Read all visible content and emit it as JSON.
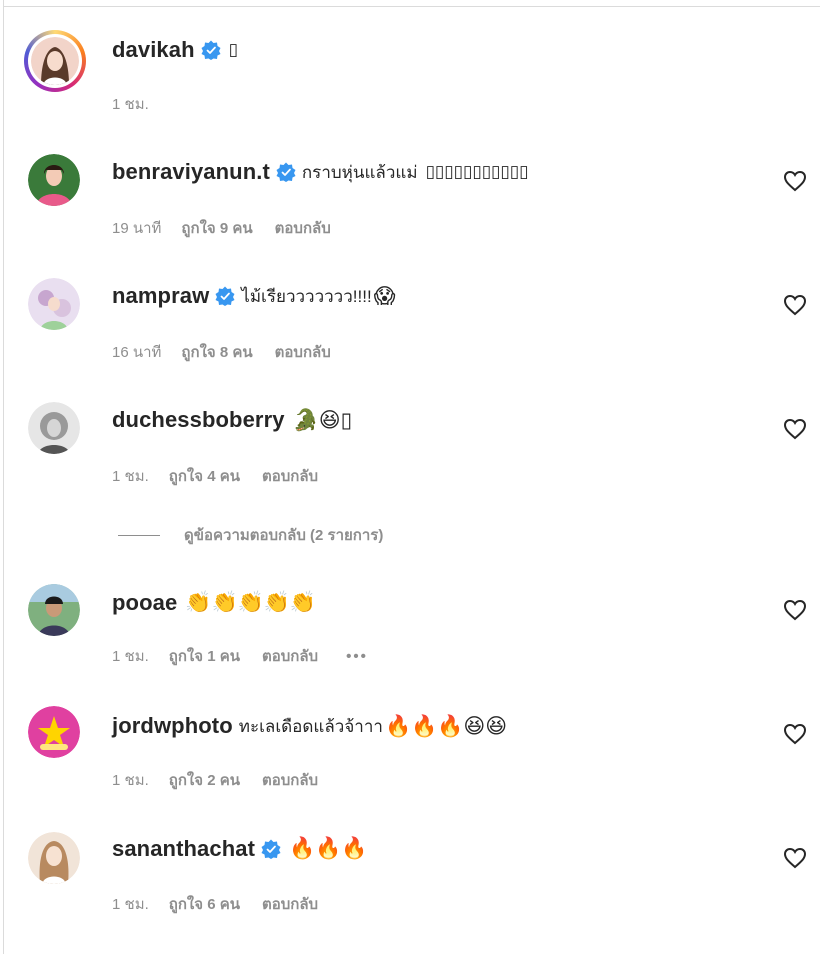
{
  "comments": [
    {
      "username": "davikah",
      "verified": true,
      "text": "",
      "emoji": "▯",
      "time": "1 ชม.",
      "likes": "",
      "reply": "",
      "avatar_colors": [
        "#f2d4c9",
        "#5a3a2a"
      ],
      "has_heart": false
    },
    {
      "username": "benraviyanun.t",
      "verified": true,
      "text": "กราบหุ่นแล้วแม่",
      "emoji": "▯▯▯▯▯▯▯▯▯▯▯",
      "time": "19 นาที",
      "likes": "ถูกใจ 9 คน",
      "reply": "ตอบกลับ",
      "avatar_colors": [
        "#e85a8a",
        "#3a7a3a"
      ],
      "has_heart": true
    },
    {
      "username": "nampraw",
      "verified": true,
      "text": "ไม้เรียววววววว!!!!",
      "emoji": "😱",
      "time": "16 นาที",
      "likes": "ถูกใจ 8 คน",
      "reply": "ตอบกลับ",
      "avatar_colors": [
        "#e9dff0",
        "#c7a6cf"
      ],
      "has_heart": true
    },
    {
      "username": "duchessboberry",
      "verified": false,
      "text": "",
      "emoji": "🐊😆▯",
      "time": "1 ชม.",
      "likes": "ถูกใจ 4 คน",
      "reply": "ตอบกลับ",
      "avatar_colors": [
        "#dcdcdc",
        "#555555"
      ],
      "has_heart": true
    },
    {
      "username": "pooae",
      "verified": false,
      "text": "",
      "emoji": "👏👏👏👏👏",
      "time": "1 ชม.",
      "likes": "ถูกใจ 1 คน",
      "reply": "ตอบกลับ",
      "more": "•••",
      "avatar_colors": [
        "#7fb07f",
        "#3a3a5a"
      ],
      "has_heart": true
    },
    {
      "username": "jordwphoto",
      "verified": false,
      "text": "ทะเลเดือดแล้วจ้าาา",
      "emoji": "🔥🔥🔥😆😆",
      "time": "1 ชม.",
      "likes": "ถูกใจ 2 คน",
      "reply": "ตอบกลับ",
      "avatar_colors": [
        "#e040a0",
        "#ffd400"
      ],
      "has_heart": true
    },
    {
      "username": "sananthachat",
      "verified": true,
      "text": "",
      "emoji": "🔥🔥🔥",
      "time": "1 ชม.",
      "likes": "ถูกใจ 6 คน",
      "reply": "ตอบกลับ",
      "avatar_colors": [
        "#f1e4d8",
        "#b88a60"
      ],
      "has_heart": true
    }
  ],
  "view_replies": "ดูข้อความตอบกลับ (2 รายการ)",
  "colors": {
    "verified": "#3897f0",
    "secondary_text": "#8e8e8e",
    "primary_text": "#262626"
  },
  "icons": {
    "verified": "verified-badge-icon",
    "like": "heart-icon"
  }
}
